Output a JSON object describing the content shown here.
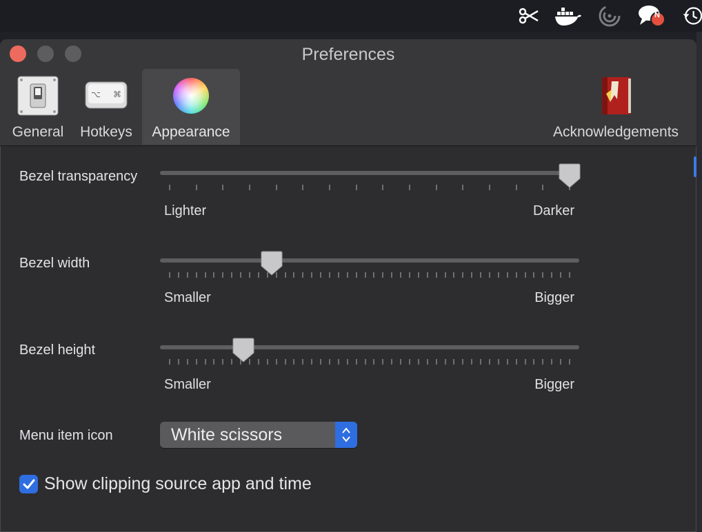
{
  "menubar": {
    "icons": [
      "scissors-icon",
      "docker-icon",
      "spiral-icon",
      "chat-bubble-icon",
      "time-machine-icon"
    ],
    "badge_text": "N"
  },
  "window": {
    "title": "Preferences",
    "tabs": [
      {
        "label": "General",
        "icon": "light-switch-icon",
        "active": false
      },
      {
        "label": "Hotkeys",
        "icon": "keyboard-key-icon",
        "active": false
      },
      {
        "label": "Appearance",
        "icon": "color-wheel-icon",
        "active": true
      },
      {
        "label": "Acknowledgements",
        "icon": "red-book-icon",
        "active": false
      }
    ]
  },
  "appearance": {
    "bezel_transparency": {
      "label": "Bezel transparency",
      "min_label": "Lighter",
      "max_label": "Darker",
      "value": 1.0,
      "tick_count": 16
    },
    "bezel_width": {
      "label": "Bezel width",
      "min_label": "Smaller",
      "max_label": "Bigger",
      "value": 0.255,
      "tick_count": 46
    },
    "bezel_height": {
      "label": "Bezel height",
      "min_label": "Smaller",
      "max_label": "Bigger",
      "value": 0.185,
      "tick_count": 46
    },
    "menu_item_icon": {
      "label": "Menu item icon",
      "selected": "White scissors"
    },
    "show_source": {
      "label": "Show clipping source app and time",
      "checked": true
    }
  },
  "colors": {
    "accent": "#2f6ee0",
    "close": "#ed6a5e",
    "window_bg": "#2d2d30"
  }
}
